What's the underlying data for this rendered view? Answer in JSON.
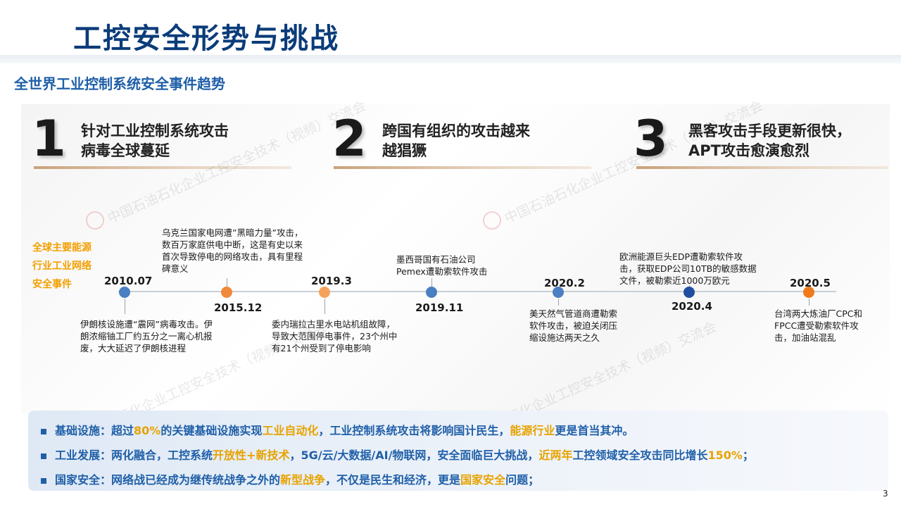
{
  "header": {
    "title": "工控安全形势与挑战"
  },
  "section": {
    "subtitle": "全世界工业控制系统安全事件趋势"
  },
  "trends": [
    {
      "number": "1",
      "line1": "针对工业控制系统攻击",
      "line2": "病毒全球蔓延"
    },
    {
      "number": "2",
      "line1": "跨国有组织的攻击越来",
      "line2": "越猖獗"
    },
    {
      "number": "3",
      "line1": "黑客攻击手段更新很快，",
      "line2": "APT攻击愈演愈烈"
    }
  ],
  "side_label": {
    "line1": "全球主要能源",
    "line2": "行业工业网络",
    "line3": "安全事件"
  },
  "timeline": [
    {
      "year": "2010.07",
      "color": "#4a7fc1",
      "desc": [
        "伊朗核设施遭“震网”病毒攻击。伊",
        "朗浓缩铀工厂约五分之一离心机报",
        "废，大大延迟了伊朗核进程"
      ]
    },
    {
      "year": "2015.12",
      "color": "#f08a3a",
      "desc": [
        "乌克兰国家电网遭”黑暗力量”攻击，",
        "数百万家庭供电中断，这是有史以来",
        "首次导致停电的网络攻击，具有里程",
        "碑意义"
      ]
    },
    {
      "year": "2019.3",
      "color": "#f5a35c",
      "desc": [
        "委内瑞拉古里水电站机组故障，",
        "导致大范围停电事件，23个州中",
        "有21个州受到了停电影响"
      ]
    },
    {
      "year": "2019.11",
      "color": "#4a7fc1",
      "desc": [
        "墨西哥国有石油公司",
        "Pemex遭勒索软件攻击"
      ]
    },
    {
      "year": "2020.2",
      "color": "#4a7fc1",
      "desc": [
        "美天然气管道商遭勒索",
        "软件攻击，被迫关闭压",
        "缩设施达两天之久"
      ]
    },
    {
      "year": "2020.4",
      "color": "#1f4fa0",
      "desc": [
        "欧洲能源巨头EDP遭勒索软件攻",
        "击，获取EDP公司10TB的敏感数据",
        "文件，被勒索近1000万欧元"
      ]
    },
    {
      "year": "2020.5",
      "color": "#f07a1a",
      "desc": [
        "台湾两大炼油厂CPC和",
        "FPCC遭受勒索软件攻",
        "击，加油站混乱"
      ]
    }
  ],
  "bullets": [
    {
      "label": "基础设施：",
      "parts": [
        "超过",
        "80%",
        "的关键基础设施实现",
        "工业自动化",
        "，工业控制系统攻击将影响国计民生，",
        "能源行业",
        "更是首当其冲。"
      ]
    },
    {
      "label": "工业发展：",
      "parts": [
        "两化融合，工控系统",
        "开放性+新技术",
        "，5G/云/大数据/AI/物联网，安全面临巨大挑战，",
        "近两年",
        "工控领域安全攻击同比增长",
        "150%",
        "；"
      ]
    },
    {
      "label": "国家安全：",
      "parts": [
        "网络战已经成为继传统战争之外的",
        "新型战争",
        "，不仅是民生和经济，更是",
        "国家安全",
        "问题；"
      ]
    }
  ],
  "watermark": {
    "text": "中国石油石化企业工控安全技术（视频）交流会"
  },
  "footer": {
    "page_number": "3"
  }
}
